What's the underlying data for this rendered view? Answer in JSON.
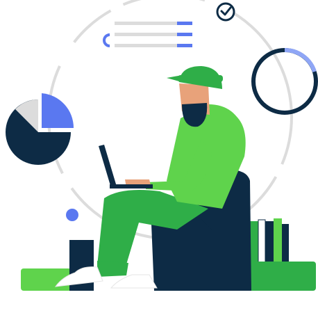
{
  "illustration": {
    "subject": "person-working-on-laptop-in-armchair",
    "icons": [
      "check-circle-icon",
      "text-lines-icon",
      "pie-chart-icon",
      "donut-progress-icon",
      "dot-icon"
    ],
    "colors": {
      "green": "#5fd34c",
      "dark_green": "#2fae48",
      "navy": "#0d2b45",
      "blue": "#5a78f0",
      "light_gray": "#dcdcdc",
      "skin": "#e8a27a",
      "white": "#ffffff"
    }
  }
}
